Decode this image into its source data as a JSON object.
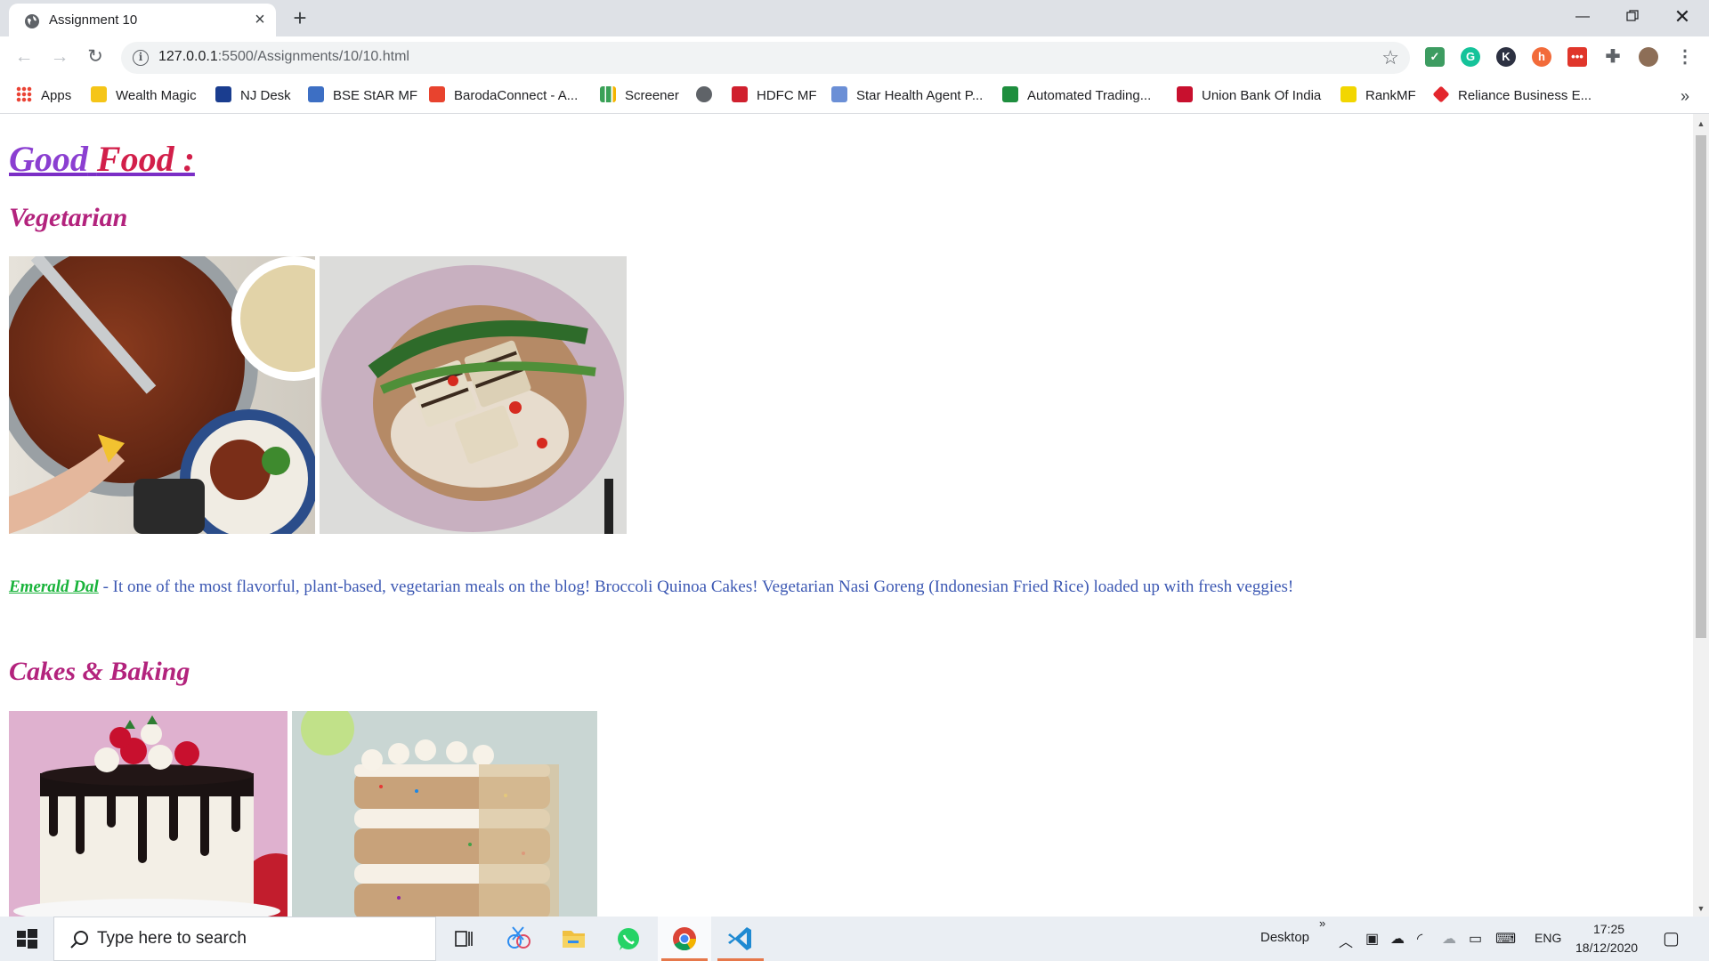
{
  "browser": {
    "tab_title": "Assignment 10",
    "url_host": "127.0.0.1",
    "url_path": ":5500/Assignments/10/10.html"
  },
  "bookmarks": [
    {
      "label": "Apps",
      "color": "#4285f4"
    },
    {
      "label": "Wealth Magic",
      "color": "#f5c518"
    },
    {
      "label": "NJ Desk",
      "color": "#1a3d8f"
    },
    {
      "label": "BSE StAR MF",
      "color": "#3d6fc4"
    },
    {
      "label": "BarodaConnect - A...",
      "color": "#e8432e"
    },
    {
      "label": "Screener",
      "color": "#3aa157"
    },
    {
      "label": "",
      "color": "#5f6368"
    },
    {
      "label": "HDFC MF",
      "color": "#d0202e"
    },
    {
      "label": "Star Health Agent P...",
      "color": "#6b8fd6"
    },
    {
      "label": "Automated Trading...",
      "color": "#1e8e3e"
    },
    {
      "label": "Union Bank Of India",
      "color": "#c8102e"
    },
    {
      "label": "RankMF",
      "color": "#f2d600"
    },
    {
      "label": "Reliance Business E...",
      "color": "#e3262d"
    }
  ],
  "page": {
    "title_part1": "Good",
    "title_part2": "Food :",
    "section1_title": "Vegetarian",
    "link_text": "Emerald Dal",
    "description": " - It one of the most flavorful, plant-based, vegetarian meals on the blog! Broccoli Quinoa Cakes! Vegetarian Nasi Goreng (Indonesian Fried Rice) loaded up with fresh veggies!",
    "section2_title": "Cakes & Baking"
  },
  "taskbar": {
    "search_placeholder": "Type here to search",
    "desktop_label": "Desktop",
    "language": "ENG",
    "time": "17:25",
    "date": "18/12/2020"
  }
}
